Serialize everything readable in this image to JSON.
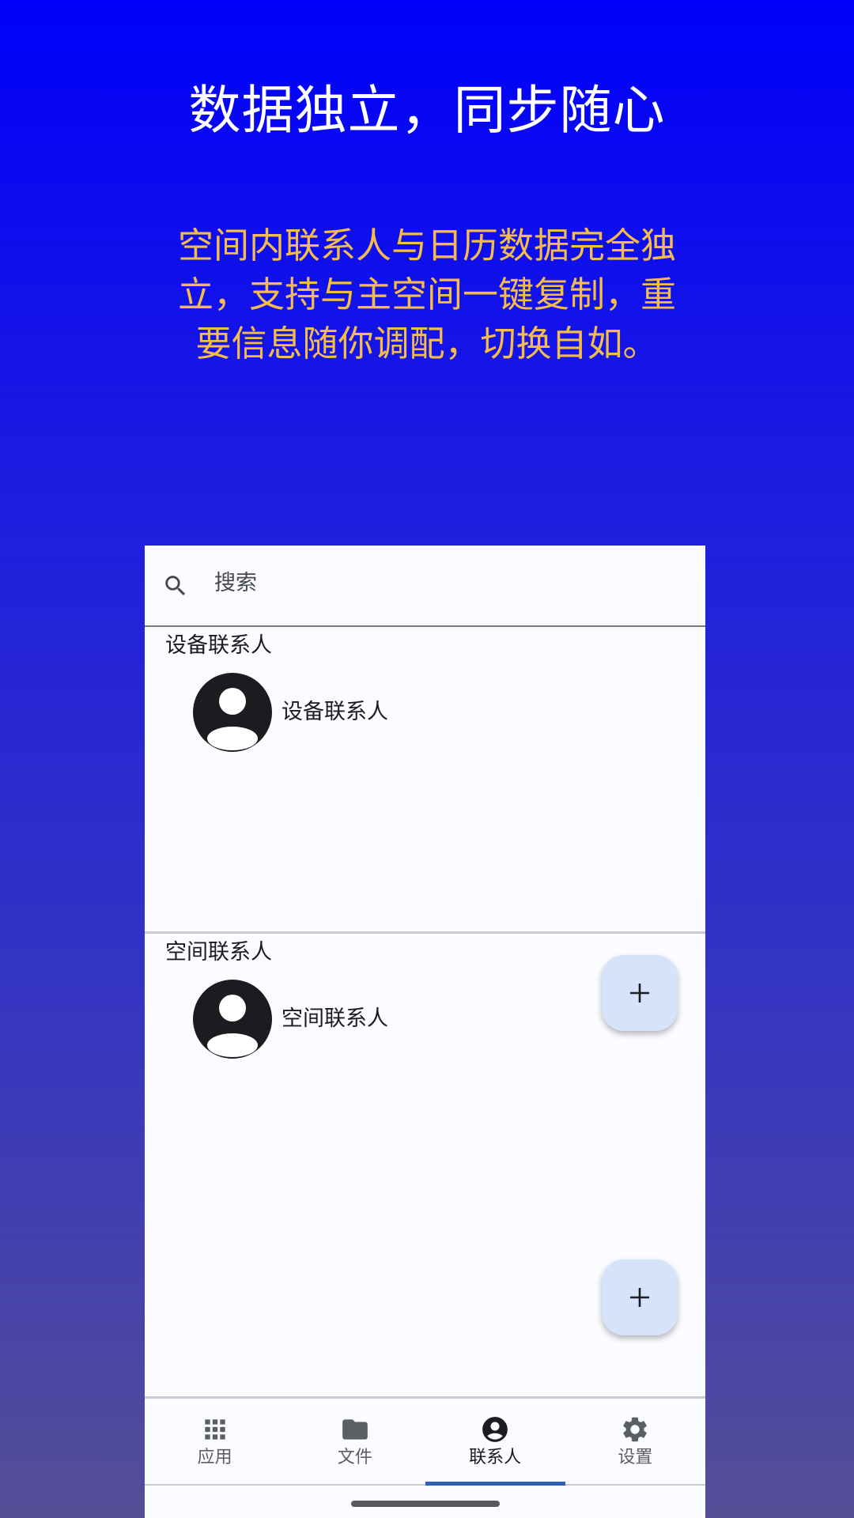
{
  "promo": {
    "headline": "数据独立，同步随心",
    "description": "空间内联系人与日历数据完全独立，支持与主空间一键复制，重要信息随你调配，切换自如。"
  },
  "app": {
    "search": {
      "placeholder": "搜索",
      "icon": "search-icon"
    },
    "sections": [
      {
        "title": "设备联系人",
        "contacts": [
          {
            "name": "设备联系人",
            "icon": "person-avatar-icon"
          }
        ],
        "fab_icon": "plus-icon"
      },
      {
        "title": "空间联系人",
        "contacts": [
          {
            "name": "空间联系人",
            "icon": "person-avatar-icon"
          }
        ],
        "fab_icon": "plus-icon"
      }
    ],
    "bottom_nav": [
      {
        "label": "应用",
        "icon": "apps-grid-icon",
        "active": false
      },
      {
        "label": "文件",
        "icon": "folder-icon",
        "active": false
      },
      {
        "label": "联系人",
        "icon": "account-circle-icon",
        "active": true
      },
      {
        "label": "设置",
        "icon": "gear-icon",
        "active": false
      }
    ]
  },
  "colors": {
    "headline": "#ffffff",
    "description": "#f5bc4a",
    "background_top": "#0000fa",
    "background_bottom": "#554e96",
    "fab": "#d6e3fb",
    "active_indicator": "#2f62b4"
  }
}
